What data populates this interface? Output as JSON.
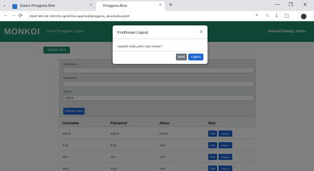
{
  "browser": {
    "tabs": [
      {
        "label": "Sistem Pengguna Web"
      },
      {
        "label": "Pengguna Akun"
      }
    ],
    "url": "45e8-180-111-128-211.ngrok-free.app/crud/pengguna_akun/index.php#"
  },
  "navbar": {
    "logo": "MONKOI",
    "links": "Home   Pengguna   Logout",
    "right_text": "Selamat Datang, admin"
  },
  "page": {
    "add_button": "Tambah Akun",
    "form": {
      "fields": [
        {
          "label": "Username",
          "value": ""
        },
        {
          "label": "Password",
          "value": ""
        },
        {
          "label": "Akses",
          "value": "admin"
        }
      ],
      "save_button": "Tambah Akun"
    },
    "table": {
      "headers": [
        "Username",
        "Password",
        "Akses",
        "Aksi"
      ],
      "rows": [
        [
          "admin",
          "admin",
          "admin"
        ],
        [
          "tima",
          "tima",
          "user"
        ],
        [
          "dito",
          "dito",
          "user"
        ],
        [
          "argo",
          "argo",
          "user"
        ]
      ],
      "edit_label": "Edit",
      "delete_label": "Hapus"
    }
  },
  "modal": {
    "title": "Konfirmasi Logout",
    "body": "Apakah anda yakin ingin keluar?",
    "cancel_label": "Batal",
    "logout_label": "Logout",
    "close_icon": "close-icon"
  },
  "colors": {
    "navbar": "#1d8a6f",
    "primary": "#1f66d1",
    "secondary": "#6c757d"
  }
}
